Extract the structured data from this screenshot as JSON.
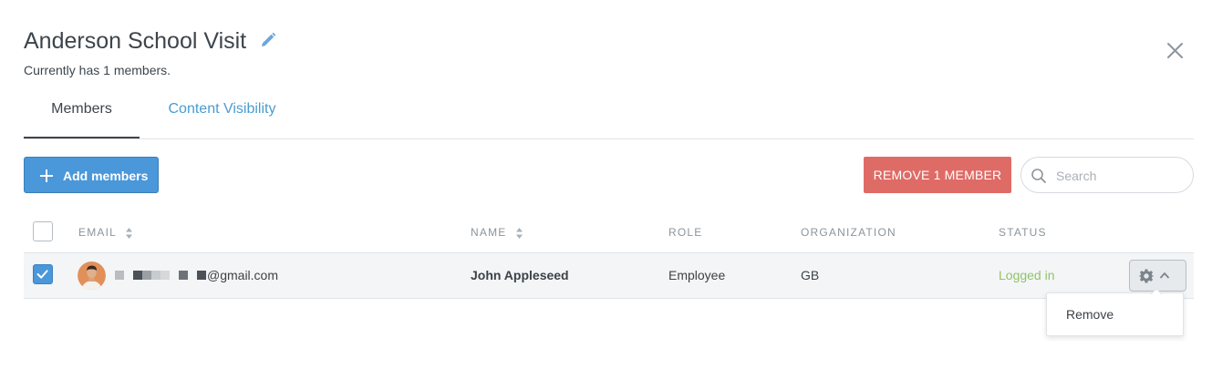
{
  "header": {
    "title": "Anderson School Visit",
    "subtitle": "Currently has 1 members."
  },
  "tabs": [
    {
      "label": "Members",
      "active": true
    },
    {
      "label": "Content Visibility",
      "active": false
    }
  ],
  "toolbar": {
    "add_label": "Add members",
    "remove_label": "REMOVE 1 MEMBER",
    "search_placeholder": "Search"
  },
  "table": {
    "columns": [
      "EMAIL",
      "NAME",
      "ROLE",
      "ORGANIZATION",
      "STATUS"
    ],
    "rows": [
      {
        "selected": true,
        "email": "@gmail.com",
        "name": "John Appleseed",
        "role": "Employee",
        "organization": "GB",
        "status": "Logged in"
      }
    ]
  },
  "row_menu": {
    "items": [
      "Remove"
    ]
  },
  "colors": {
    "primary": "#4a97d9",
    "danger": "#df6b66",
    "link": "#4a9cd1",
    "status_ok": "#8fc46a"
  },
  "icons": [
    "edit-icon",
    "close-icon",
    "plus-icon",
    "search-icon",
    "sort-icon",
    "checkmark-icon",
    "gear-icon",
    "chevron-up-icon"
  ]
}
